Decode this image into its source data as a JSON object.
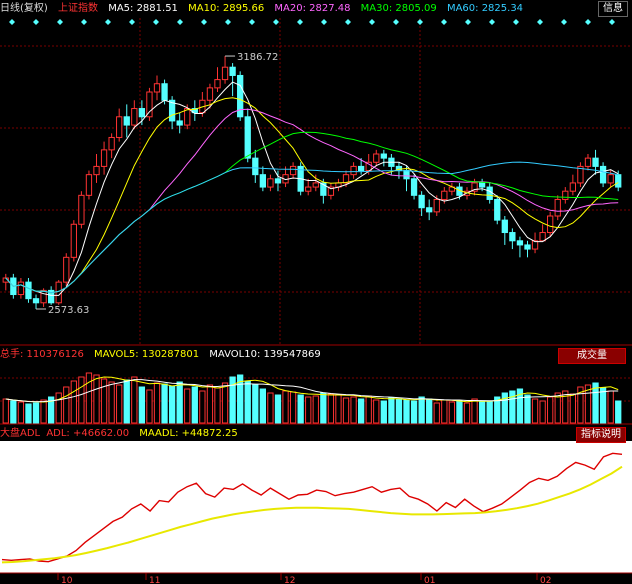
{
  "main_header": {
    "period": "日线(复权)",
    "index_name": "上证指数",
    "ma": [
      {
        "label": "MA5: 2881.51",
        "color": "#ffffff"
      },
      {
        "label": "MA10: 2895.66",
        "color": "#ffff00"
      },
      {
        "label": "MA20: 2827.48",
        "color": "#ff66ff"
      },
      {
        "label": "MA30: 2805.09",
        "color": "#00ff00"
      },
      {
        "label": "MA60: 2825.34",
        "color": "#33ccff"
      }
    ],
    "info_button": "信息"
  },
  "volume_header": {
    "total": "总手: 110376126",
    "mavol5": "MAVOL5: 130287801",
    "mavol10": "MAVOL10: 139547869",
    "button": "成交量"
  },
  "adl_header": {
    "title": "大盘ADL",
    "adl": "ADL: +46662.00",
    "maadl": "MAADL: +44872.25",
    "button": "指标说明"
  },
  "annotations": {
    "high": "3186.72",
    "low": "2573.63"
  },
  "x_axis_labels": [
    "10",
    "11",
    "12",
    "01",
    "02"
  ],
  "colors": {
    "up": "#ff3333",
    "down": "#55ffff",
    "grid": "#7a0000",
    "bg": "#000000"
  },
  "chart_data": {
    "type": "candlestick",
    "price_ylim": [
      2500,
      3250
    ],
    "candles": [
      [
        2640,
        2650,
        2620,
        2660
      ],
      [
        2650,
        2610,
        2600,
        2660
      ],
      [
        2610,
        2640,
        2600,
        2650
      ],
      [
        2640,
        2600,
        2590,
        2650
      ],
      [
        2600,
        2590,
        2575,
        2610
      ],
      [
        2590,
        2620,
        2580,
        2625
      ],
      [
        2620,
        2590,
        2585,
        2630
      ],
      [
        2590,
        2640,
        2585,
        2645
      ],
      [
        2640,
        2700,
        2630,
        2710
      ],
      [
        2700,
        2780,
        2690,
        2790
      ],
      [
        2780,
        2850,
        2770,
        2860
      ],
      [
        2850,
        2900,
        2840,
        2910
      ],
      [
        2900,
        2920,
        2880,
        2950
      ],
      [
        2920,
        2960,
        2900,
        2980
      ],
      [
        2960,
        2990,
        2940,
        3000
      ],
      [
        2990,
        3040,
        2980,
        3060
      ],
      [
        3040,
        3020,
        2990,
        3070
      ],
      [
        3020,
        3060,
        3010,
        3080
      ],
      [
        3060,
        3040,
        3020,
        3080
      ],
      [
        3040,
        3100,
        3030,
        3110
      ],
      [
        3100,
        3120,
        3080,
        3140
      ],
      [
        3120,
        3080,
        3070,
        3130
      ],
      [
        3080,
        3030,
        3010,
        3090
      ],
      [
        3030,
        3020,
        3000,
        3050
      ],
      [
        3020,
        3060,
        3010,
        3070
      ],
      [
        3060,
        3050,
        3030,
        3080
      ],
      [
        3050,
        3080,
        3040,
        3100
      ],
      [
        3080,
        3110,
        3060,
        3120
      ],
      [
        3110,
        3130,
        3100,
        3160
      ],
      [
        3130,
        3160,
        3120,
        3187
      ],
      [
        3160,
        3140,
        3090,
        3170
      ],
      [
        3140,
        3040,
        3030,
        3150
      ],
      [
        3040,
        2940,
        2930,
        3060
      ],
      [
        2940,
        2900,
        2880,
        2960
      ],
      [
        2900,
        2870,
        2860,
        2920
      ],
      [
        2870,
        2890,
        2860,
        2900
      ],
      [
        2890,
        2880,
        2860,
        2910
      ],
      [
        2880,
        2900,
        2870,
        2920
      ],
      [
        2900,
        2920,
        2890,
        2930
      ],
      [
        2920,
        2860,
        2850,
        2930
      ],
      [
        2860,
        2870,
        2850,
        2890
      ],
      [
        2870,
        2880,
        2860,
        2900
      ],
      [
        2880,
        2850,
        2830,
        2890
      ],
      [
        2850,
        2870,
        2840,
        2880
      ],
      [
        2870,
        2880,
        2860,
        2890
      ],
      [
        2880,
        2900,
        2870,
        2910
      ],
      [
        2900,
        2920,
        2890,
        2930
      ],
      [
        2920,
        2910,
        2900,
        2940
      ],
      [
        2910,
        2930,
        2900,
        2950
      ],
      [
        2930,
        2950,
        2920,
        2960
      ],
      [
        2950,
        2940,
        2920,
        2960
      ],
      [
        2940,
        2920,
        2900,
        2950
      ],
      [
        2920,
        2910,
        2890,
        2930
      ],
      [
        2910,
        2890,
        2860,
        2920
      ],
      [
        2890,
        2850,
        2840,
        2900
      ],
      [
        2850,
        2820,
        2800,
        2860
      ],
      [
        2820,
        2810,
        2790,
        2840
      ],
      [
        2810,
        2840,
        2800,
        2850
      ],
      [
        2840,
        2860,
        2830,
        2870
      ],
      [
        2860,
        2870,
        2850,
        2880
      ],
      [
        2870,
        2850,
        2840,
        2880
      ],
      [
        2850,
        2860,
        2840,
        2870
      ],
      [
        2860,
        2880,
        2850,
        2890
      ],
      [
        2880,
        2870,
        2860,
        2890
      ],
      [
        2870,
        2840,
        2830,
        2880
      ],
      [
        2840,
        2790,
        2780,
        2850
      ],
      [
        2790,
        2760,
        2730,
        2800
      ],
      [
        2760,
        2740,
        2720,
        2770
      ],
      [
        2740,
        2730,
        2700,
        2750
      ],
      [
        2730,
        2720,
        2700,
        2740
      ],
      [
        2720,
        2740,
        2710,
        2760
      ],
      [
        2740,
        2760,
        2740,
        2780
      ],
      [
        2760,
        2800,
        2750,
        2810
      ],
      [
        2800,
        2840,
        2790,
        2850
      ],
      [
        2840,
        2860,
        2830,
        2870
      ],
      [
        2860,
        2880,
        2850,
        2900
      ],
      [
        2880,
        2920,
        2870,
        2930
      ],
      [
        2920,
        2940,
        2910,
        2950
      ],
      [
        2940,
        2920,
        2900,
        2960
      ],
      [
        2920,
        2880,
        2870,
        2930
      ],
      [
        2880,
        2900,
        2870,
        2910
      ],
      [
        2900,
        2870,
        2860,
        2910
      ]
    ],
    "volume_ylim": [
      0,
      300000000
    ],
    "volume": [
      120,
      110,
      105,
      95,
      100,
      115,
      130,
      150,
      180,
      210,
      230,
      250,
      240,
      220,
      205,
      190,
      215,
      230,
      180,
      165,
      200,
      195,
      185,
      205,
      170,
      180,
      160,
      190,
      175,
      200,
      230,
      240,
      210,
      190,
      170,
      150,
      140,
      160,
      155,
      140,
      130,
      135,
      150,
      145,
      140,
      125,
      130,
      120,
      135,
      115,
      110,
      125,
      120,
      115,
      110,
      130,
      120,
      100,
      115,
      105,
      110,
      100,
      120,
      110,
      105,
      130,
      150,
      160,
      170,
      140,
      120,
      110,
      130,
      150,
      160,
      145,
      180,
      190,
      200,
      175,
      160,
      110
    ],
    "adl_ylim": [
      30000,
      48000
    ],
    "adl": [
      31500,
      31400,
      31500,
      31600,
      31300,
      31200,
      31600,
      32000,
      32800,
      34000,
      35000,
      36000,
      37000,
      37600,
      38800,
      39500,
      38500,
      40000,
      39800,
      41200,
      42000,
      42500,
      41000,
      40500,
      41800,
      41600,
      42400,
      41500,
      40800,
      41800,
      41000,
      40200,
      40800,
      40900,
      41500,
      41300,
      40700,
      41000,
      41200,
      41600,
      42000,
      41200,
      41600,
      41800,
      40600,
      40200,
      39500,
      38500,
      39700,
      39000,
      40200,
      39200,
      38400,
      38900,
      39500,
      40500,
      41500,
      42600,
      43200,
      42900,
      43500,
      44600,
      45500,
      45100,
      44500,
      46300,
      46800,
      46662
    ],
    "maadl": [
      31100,
      31150,
      31250,
      31400,
      31550,
      31700,
      31900,
      32150,
      32450,
      32800,
      33150,
      33550,
      33950,
      34400,
      34850,
      35300,
      35750,
      36200,
      36600,
      37000,
      37400,
      37700,
      38000,
      38250,
      38450,
      38650,
      38800,
      38900,
      38950,
      38950,
      38950,
      38900,
      38850,
      38800,
      38650,
      38500,
      38350,
      38200,
      38100,
      38000,
      38000,
      38000,
      38050,
      38100,
      38150,
      38200,
      38300,
      38450,
      38650,
      38900,
      39200,
      39550,
      40000,
      40500,
      41000,
      41600,
      42300,
      43100,
      43900,
      44872
    ]
  }
}
